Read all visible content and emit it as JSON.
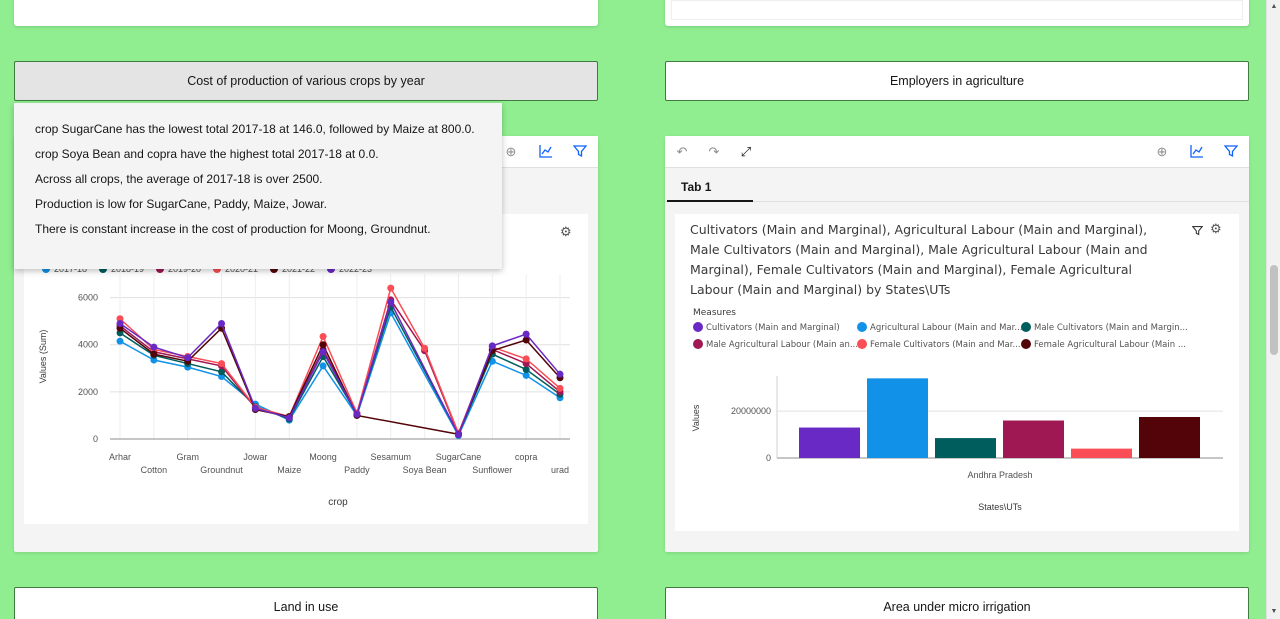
{
  "buttons": {
    "cost_of_production": "Cost of production of various crops by year",
    "employers": "Employers in agriculture",
    "land_in_use": "Land in use",
    "micro_irrigation": "Area under micro irrigation"
  },
  "insights": [
    "crop SugarCane has the lowest total 2017-18 at 146.0, followed by Maize at 800.0.",
    "crop Soya Bean and copra have the highest total 2017-18 at 0.0.",
    "Across all crops, the average of 2017-18 is over 2500.",
    "Production is low for SugarCane, Paddy, Maize, Jowar.",
    "There is constant increase in the cost of production for Moong, Groundnut."
  ],
  "right_panel": {
    "tab_label": "Tab 1",
    "title": "Cultivators (Main and Marginal), Agricultural Labour (Main and Marginal), Male Cultivators (Main and Marginal), Male Agricultural Labour (Main and Marginal), Female Cultivators (Main and Marginal), Female Agricultural Labour (Main and Marginal) by States\\UTs",
    "legend_title": "Measures",
    "legend": [
      "Cultivators (Main and Marginal)",
      "Agricultural Labour (Main and Mar...",
      "Male Cultivators (Main and Margin...",
      "Male Agricultural Labour (Main an...",
      "Female Cultivators (Main and Mar...",
      "Female Agricultural Labour (Main ..."
    ]
  },
  "colors": {
    "background": "#90ee90",
    "accent": "#0f62fe"
  },
  "chart_data": [
    {
      "type": "line",
      "xlabel": "crop",
      "ylabel": "Values (Sum)",
      "ylim": [
        0,
        7000
      ],
      "yticks": [
        "0",
        "2000",
        "4000",
        "6000"
      ],
      "grid": true,
      "legend_placement": "top-left",
      "legend_labels": [
        "2017-18",
        "2018-19",
        "2019-20",
        "2020-21",
        "2021-22",
        "2022-23"
      ],
      "categories": [
        "Arhar",
        "Cotton",
        "Gram",
        "Groundnut",
        "Jowar",
        "Maize",
        "Moong",
        "Paddy",
        "Sesamum",
        "Soya Bean",
        "SugarCane",
        "Sunflower",
        "copra",
        "urad"
      ],
      "series": [
        {
          "name": "2017-18",
          "color": "#1192e8",
          "values": [
            4150,
            3350,
            3050,
            2650,
            1480,
            800,
            3100,
            1000,
            5350,
            null,
            146,
            3300,
            2700,
            1750
          ]
        },
        {
          "name": "2018-19",
          "color": "#005d5d",
          "values": [
            4500,
            3550,
            3200,
            2850,
            1380,
            850,
            3500,
            1050,
            5600,
            null,
            200,
            3600,
            2950,
            1900
          ]
        },
        {
          "name": "2019-20",
          "color": "#9f1853",
          "values": [
            4800,
            3700,
            3400,
            3100,
            1320,
            900,
            3800,
            1050,
            5900,
            3750,
            200,
            3800,
            3200,
            2000
          ]
        },
        {
          "name": "2020-21",
          "color": "#fa4d56",
          "values": [
            5100,
            3800,
            3500,
            3200,
            1350,
            950,
            4350,
            1100,
            6400,
            3850,
            250,
            3900,
            3400,
            2150
          ]
        },
        {
          "name": "2021-22",
          "color": "#520408",
          "values": [
            4700,
            3600,
            3300,
            4700,
            1250,
            950,
            4000,
            1000,
            null,
            null,
            200,
            3750,
            4200,
            2600
          ]
        },
        {
          "name": "2022-23",
          "color": "#6929c4",
          "values": [
            4900,
            3900,
            3450,
            4900,
            1300,
            900,
            3700,
            1050,
            5800,
            null,
            180,
            3950,
            4450,
            2750
          ]
        }
      ]
    },
    {
      "type": "bar",
      "xlabel": "States\\UTs",
      "ylabel": "Values",
      "categories": [
        "Andhra Pradesh"
      ],
      "yticks": [
        "0",
        "20000000"
      ],
      "series": [
        {
          "name": "Cultivators (Main and Marginal)",
          "color": "#6929c4",
          "values": [
            13000000
          ]
        },
        {
          "name": "Agricultural Labour (Main and Mar...",
          "color": "#1192e8",
          "values": [
            34000000
          ]
        },
        {
          "name": "Male Cultivators (Main and Margin...",
          "color": "#005d5d",
          "values": [
            8500000
          ]
        },
        {
          "name": "Male Agricultural Labour (Main an...",
          "color": "#9f1853",
          "values": [
            16000000
          ]
        },
        {
          "name": "Female Cultivators (Main and Mar...",
          "color": "#fa4d56",
          "values": [
            4000000
          ]
        },
        {
          "name": "Female Agricultural Labour (Main ...",
          "color": "#520408",
          "values": [
            17500000
          ]
        }
      ]
    }
  ]
}
